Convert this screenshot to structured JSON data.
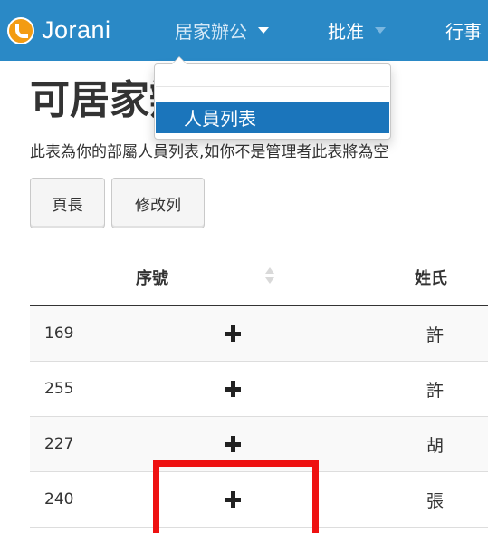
{
  "navbar": {
    "brand": "Jorani",
    "home_menu": "居家辦公",
    "approve_menu": "批准",
    "calendar_menu": "行事"
  },
  "dropdown": {
    "active_item": "人員列表"
  },
  "page": {
    "title": "可居家辦公人員列表",
    "description": "此表為你的部屬人員列表,如你不是管理者此表將為空"
  },
  "toolbar": {
    "lead_button": "頁長",
    "columns_button": "修改列"
  },
  "table": {
    "headers": {
      "id": "序號",
      "surname": "姓氏"
    },
    "rows": [
      {
        "id": "169",
        "surname": "許",
        "action_icon": "plus-icon"
      },
      {
        "id": "255",
        "surname": "許",
        "action_icon": "plus-icon"
      },
      {
        "id": "227",
        "surname": "胡",
        "action_icon": "plus-icon"
      },
      {
        "id": "240",
        "surname": "張",
        "action_icon": "plus-icon"
      }
    ]
  },
  "colors": {
    "navbar": "#2a89c6",
    "dropdown_active": "#1b75bb",
    "highlight": "#ee1111"
  }
}
